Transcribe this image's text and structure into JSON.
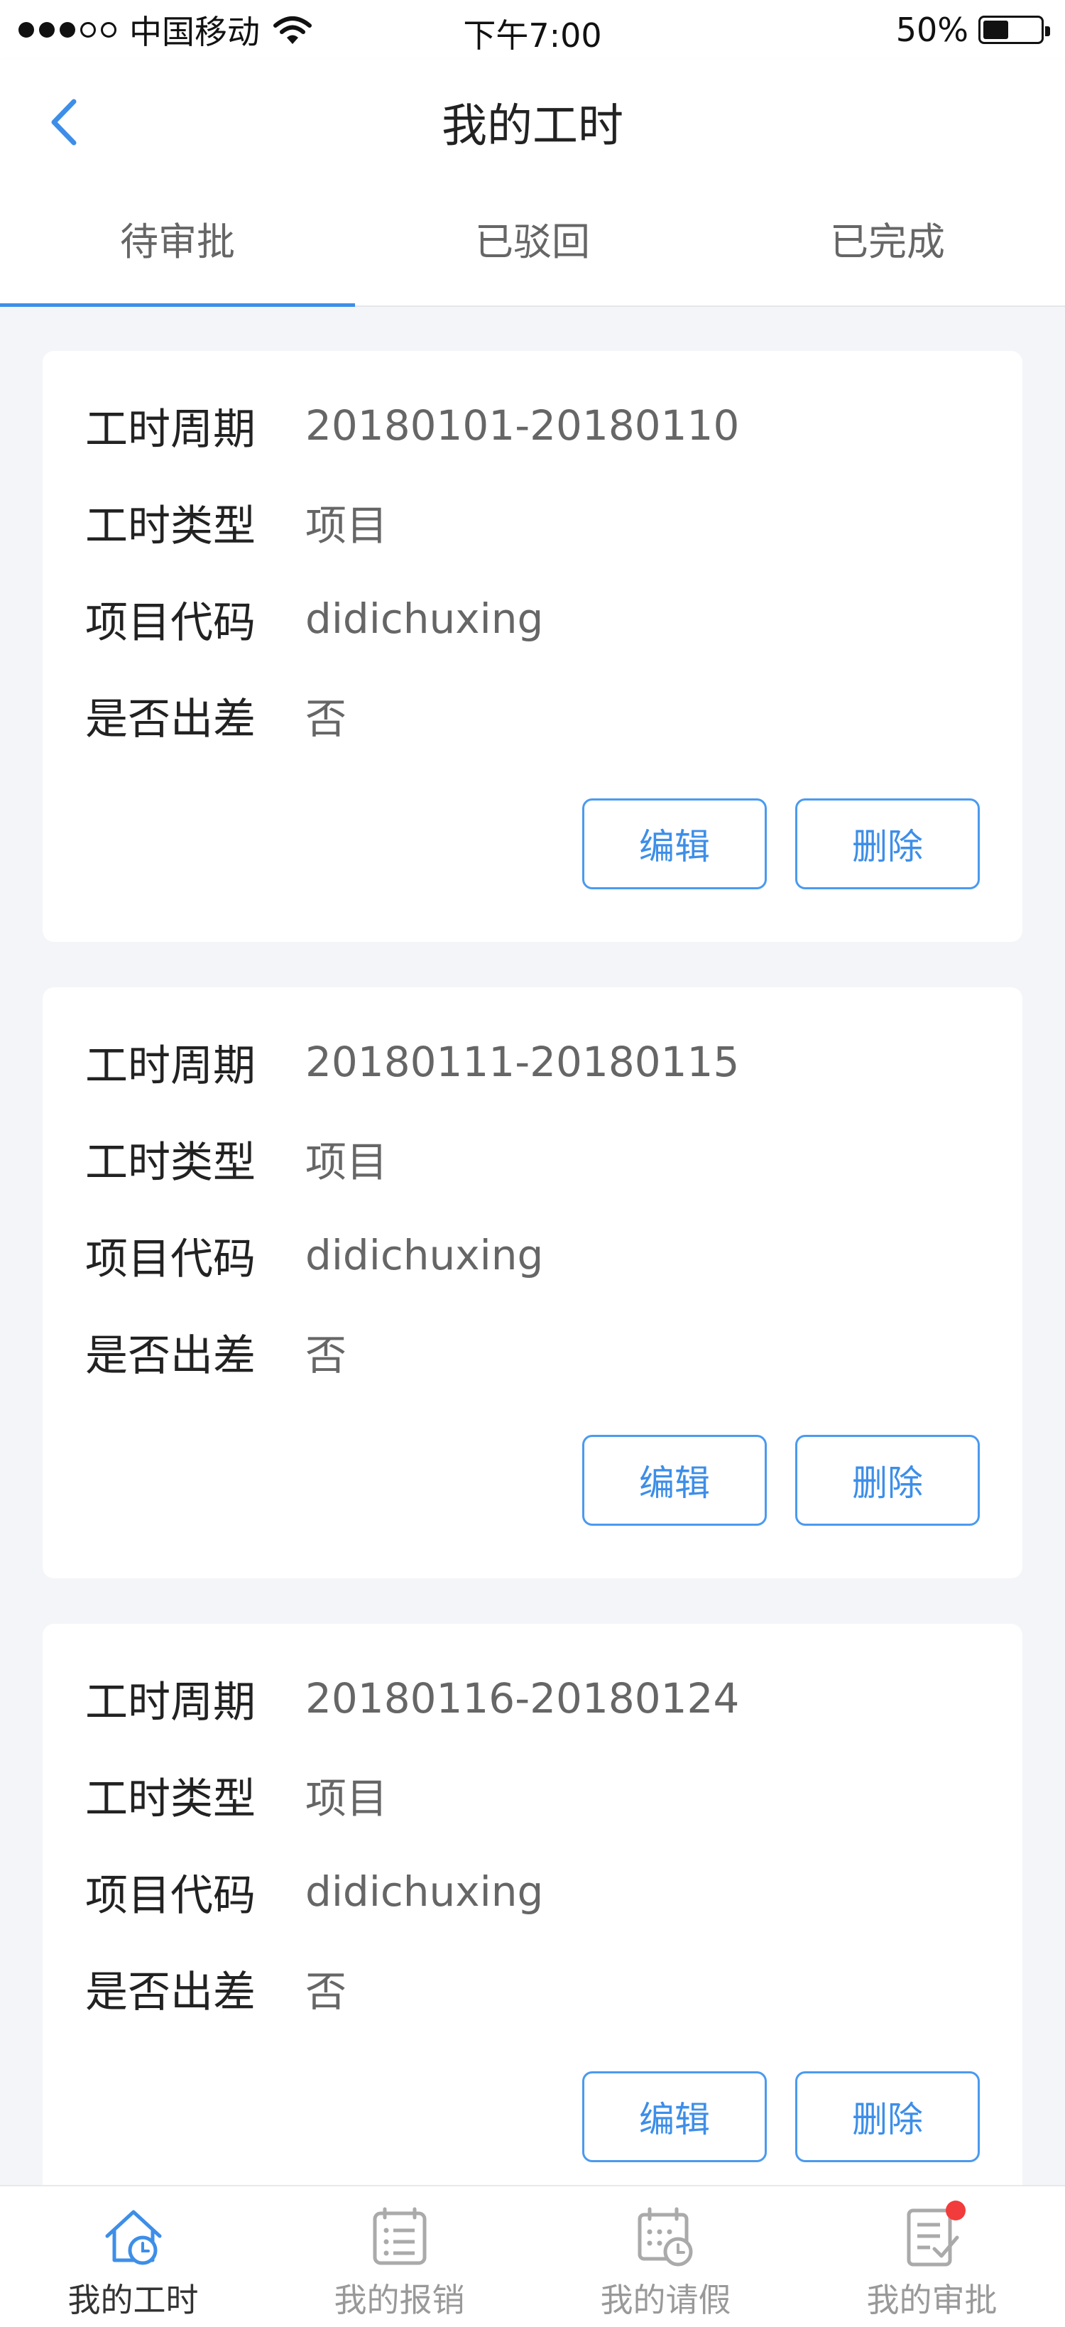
{
  "status_bar": {
    "carrier": "中国移动",
    "time": "下午7:00",
    "battery": "50%",
    "battery_level": 0.5
  },
  "nav": {
    "title": "我的工时",
    "back_icon": "chevron-left-icon"
  },
  "tabs": [
    {
      "label": "待审批",
      "active": true
    },
    {
      "label": "已驳回",
      "active": false
    },
    {
      "label": "已完成",
      "active": false
    }
  ],
  "labels": {
    "period": "工时周期",
    "type": "工时类型",
    "code": "项目代码",
    "trip": "是否出差",
    "edit": "编辑",
    "delete": "删除"
  },
  "cards": [
    {
      "period": "20180101-20180110",
      "type": "项目",
      "code": "didichuxing",
      "trip": "否"
    },
    {
      "period": "20180111-20180115",
      "type": "项目",
      "code": "didichuxing",
      "trip": "否"
    },
    {
      "period": "20180116-20180124",
      "type": "项目",
      "code": "didichuxing",
      "trip": "否"
    }
  ],
  "tab_bar": [
    {
      "label": "我的工时",
      "icon": "home-clock-icon",
      "active": true
    },
    {
      "label": "我的报销",
      "icon": "list-icon",
      "active": false
    },
    {
      "label": "我的请假",
      "icon": "calendar-clock-icon",
      "active": false
    },
    {
      "label": "我的审批",
      "icon": "approval-icon",
      "active": false,
      "badge": true
    }
  ],
  "colors": {
    "accent": "#3d8ee8",
    "badge": "#f23b3b",
    "background": "#f4f5f8"
  }
}
